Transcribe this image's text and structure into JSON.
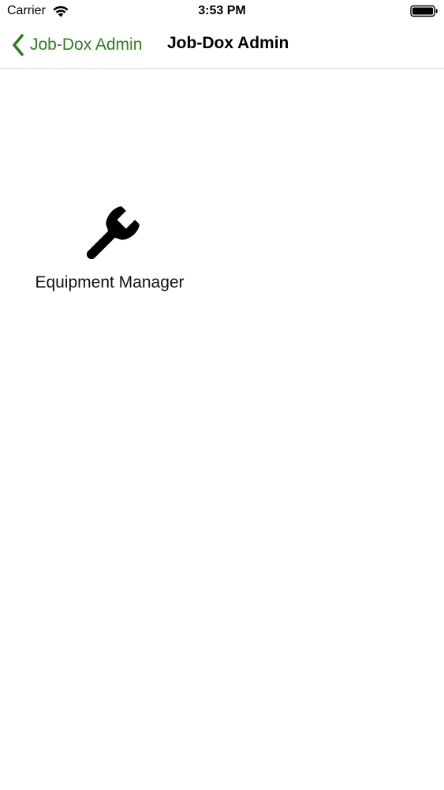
{
  "status_bar": {
    "carrier": "Carrier",
    "time": "3:53 PM",
    "wifi_icon": "wifi-icon",
    "battery_icon": "battery-icon"
  },
  "nav_bar": {
    "back_label": "Job-Dox Admin",
    "back_icon": "chevron-left-icon",
    "title": "Job-Dox Admin",
    "accent_color": "#2e7d1f"
  },
  "content": {
    "tiles": [
      {
        "label": "Equipment Manager",
        "icon": "wrench-icon"
      }
    ]
  }
}
